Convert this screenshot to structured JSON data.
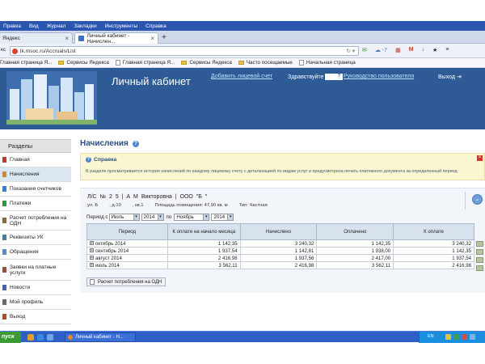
{
  "browser": {
    "menu": [
      "Правка",
      "Вид",
      "Журнал",
      "Закладки",
      "Инструменты",
      "Справка"
    ],
    "tabs": [
      {
        "label": "Яндекс"
      },
      {
        "label": "Личный кабинет - Начислен..."
      }
    ],
    "new_tab": "+",
    "url": "lk.rnsoc.ru/Accruals/List",
    "weather": "-7",
    "bookmarks": [
      "Главная страница Я...",
      "Сервисы Яндекса",
      "Главная страница Я...",
      "Сервисы Яндекса",
      "Часто посещаемые",
      "Начальная страница"
    ]
  },
  "header": {
    "title": "Личный кабинет",
    "add_account": "Добавить лицевой счет",
    "greeting": "Здравствуйте",
    "guide": "Руководство пользователя",
    "logout": "Выход"
  },
  "sidebar": {
    "heading": "Разделы",
    "items": [
      {
        "label": "Главная",
        "color": "#c0392b"
      },
      {
        "label": "Начисления",
        "color": "#d08a2a",
        "active": true
      },
      {
        "label": "Показания счетчиков",
        "color": "#3a7bd5"
      },
      {
        "label": "Платежи",
        "color": "#2e9a40"
      },
      {
        "label": "Расчет потребления на ОДН",
        "color": "#8a6a3a"
      },
      {
        "label": "Реквизиты УК",
        "color": "#4a7ab0"
      },
      {
        "label": "Обращения",
        "color": "#5a8ac0"
      },
      {
        "label": "Заявки на платные услуги",
        "color": "#a04a3a"
      },
      {
        "label": "Новости",
        "color": "#3a6ab0"
      },
      {
        "label": "Мой профиль",
        "color": "#6a6a6a"
      },
      {
        "label": "Выход",
        "color": "#b04a2a"
      }
    ]
  },
  "page": {
    "title": "Начисления",
    "help_title": "Справка",
    "help_text": "В разделе просматривается история начислений по каждому лицевому счету с детализацией по видам услуг и предусмотрена печать платежного документа за определенный период"
  },
  "account": {
    "line1": "Л/С № 2      5   |   А              М            Викторовна   |   ООО \"Б                  \"",
    "street": "ул. Б",
    "house": ", д.10",
    "flat": ", кв.1",
    "area": "Площадь помещения: 47,90 кв. м",
    "type": "Тип: Частная",
    "period_from_label": "Период с",
    "month_from": "Июль",
    "year_from": "2014",
    "period_to_label": "по",
    "month_to": "Ноябрь",
    "year_to": "2014"
  },
  "table": {
    "headers": [
      "Период",
      "К оплате на начало месяца",
      "Начислено",
      "Оплачено",
      "К оплате"
    ],
    "rows": [
      {
        "period": "октябрь 2014",
        "start": "1 142,35",
        "charged": "3 240,32",
        "paid": "1 142,35",
        "due": "3 240,32"
      },
      {
        "period": "сентябрь 2014",
        "start": "1 937,54",
        "charged": "1 142,81",
        "paid": "1 938,00",
        "due": "1 142,35"
      },
      {
        "period": "август 2014",
        "start": "2 416,98",
        "charged": "1 937,56",
        "paid": "2 417,00",
        "due": "1 937,54"
      },
      {
        "period": "июль 2014",
        "start": "3 562,11",
        "charged": "2 416,98",
        "paid": "3 562,11",
        "due": "2 416,98"
      }
    ],
    "calc_button": "Расчет потребления на ОДН"
  },
  "taskbar": {
    "start": "пуск",
    "task": "Личный кабинет - Н...",
    "lang": "EN"
  }
}
